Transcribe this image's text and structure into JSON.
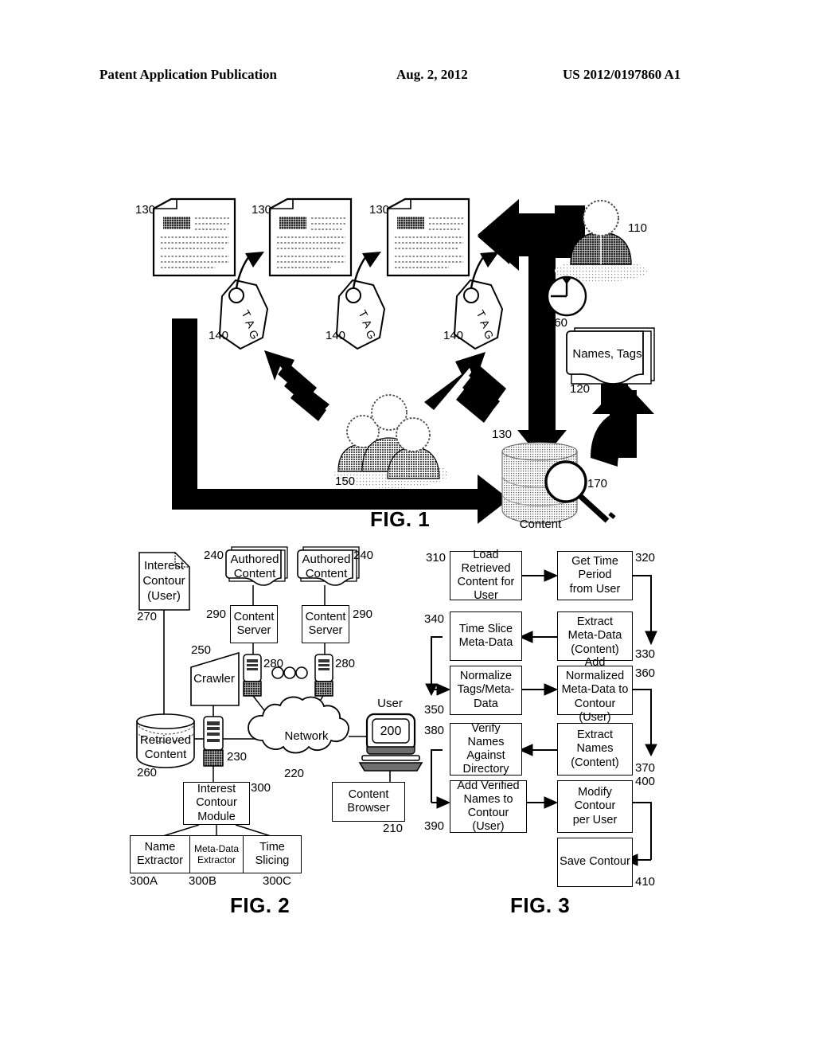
{
  "header": {
    "publication": "Patent Application Publication",
    "date": "Aug. 2, 2012",
    "number": "US 2012/0197860 A1"
  },
  "figures": [
    {
      "id": "fig1",
      "caption": "FIG. 1"
    },
    {
      "id": "fig2",
      "caption": "FIG. 2"
    },
    {
      "id": "fig3",
      "caption": "FIG. 3"
    }
  ],
  "fig1": {
    "caption": "FIG. 1",
    "documents": [
      {
        "ref": "130"
      },
      {
        "ref": "130"
      },
      {
        "ref": "130"
      }
    ],
    "tags": [
      {
        "ref": "140",
        "label_t": "T",
        "label_a": "A",
        "label_g": "G"
      },
      {
        "ref": "140",
        "label_t": "T",
        "label_a": "A",
        "label_g": "G"
      },
      {
        "ref": "140",
        "label_t": "T",
        "label_a": "A",
        "label_g": "G"
      }
    ],
    "user": {
      "ref": "110"
    },
    "clock": {
      "ref": "160"
    },
    "names_tags_doc": {
      "ref": "120",
      "label": "Names, Tags"
    },
    "group_users": {
      "ref": "150"
    },
    "content_store": {
      "ref": "130",
      "label": "Content"
    },
    "magnifier": {
      "ref": "170"
    }
  },
  "fig2": {
    "caption": "FIG. 2",
    "interest_contour_doc": {
      "ref": "270",
      "label": "Interest\nContour\n(User)",
      "line1": "Interest",
      "line2": "Contour",
      "line3": "(User)"
    },
    "authored_content": [
      {
        "ref": "240",
        "line1": "Authored",
        "line2": "Content"
      },
      {
        "ref": "240",
        "line1": "Authored",
        "line2": "Content"
      }
    ],
    "content_servers": [
      {
        "ref": "290",
        "line1": "Content",
        "line2": "Server"
      },
      {
        "ref": "290",
        "line1": "Content",
        "line2": "Server"
      }
    ],
    "routers": [
      {
        "ref": "280"
      },
      {
        "ref": "280"
      }
    ],
    "ellipsis_dots": 3,
    "crawler": {
      "ref": "250",
      "label": "Crawler"
    },
    "retrieved_content": {
      "ref": "260",
      "line1": "Retrieved",
      "line2": "Content"
    },
    "server_230": {
      "ref": "230"
    },
    "network": {
      "ref": "220",
      "label": "Network"
    },
    "user_terminal": {
      "ref": "200",
      "label": "User"
    },
    "content_browser": {
      "ref": "210",
      "line1": "Content",
      "line2": "Browser"
    },
    "interest_contour_module": {
      "ref": "300",
      "line1": "Interest",
      "line2": "Contour",
      "line3": "Module"
    },
    "module_parts": [
      {
        "ref": "300A",
        "line1": "Name",
        "line2": "Extractor"
      },
      {
        "ref": "300B",
        "line1": "Meta-Data",
        "line2": "Extractor"
      },
      {
        "ref": "300C",
        "line1": "Time",
        "line2": "Slicing"
      }
    ]
  },
  "fig3": {
    "caption": "FIG. 3",
    "steps": [
      {
        "ref": "310",
        "line1": "Load Retrieved",
        "line2": "Content for User"
      },
      {
        "ref": "320",
        "line1": "Get Time Period",
        "line2": "from User"
      },
      {
        "ref": "330",
        "line1": "Extract",
        "line2": "Meta-Data",
        "line3": "(Content)"
      },
      {
        "ref": "340",
        "line1": "Time Slice",
        "line2": "Meta-Data"
      },
      {
        "ref": "350",
        "line1": "Normalize",
        "line2": "Tags/Meta-Data"
      },
      {
        "ref": "360",
        "line1": "Add Normalized",
        "line2": "Meta-Data to",
        "line3": "Contour (User)"
      },
      {
        "ref": "370",
        "line1": "Extract Names",
        "line2": "(Content)"
      },
      {
        "ref": "380",
        "line1": "Verify Names",
        "line2": "Against",
        "line3": "Directory"
      },
      {
        "ref": "390",
        "line1": "Add Verified",
        "line2": "Names to",
        "line3": "Contour (User)"
      },
      {
        "ref": "400",
        "line1": "Modify Contour",
        "line2": "per User"
      },
      {
        "ref": "410",
        "line1": "Save Contour"
      }
    ]
  },
  "colors": {
    "ink": "#000000",
    "paper": "#ffffff",
    "shade_light": "#c9c9c9",
    "shade_mid": "#9a9a9a",
    "shade_dark": "#6e6e6e"
  }
}
